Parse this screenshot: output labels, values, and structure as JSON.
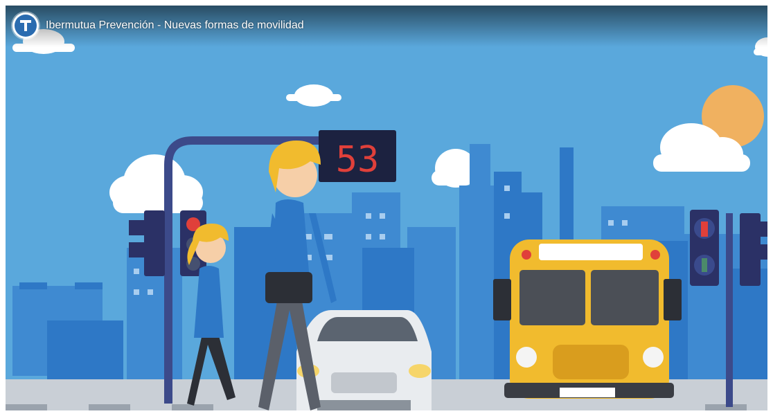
{
  "video": {
    "title": "Ibermutua Prevención - Nuevas formas de movilidad",
    "channel_logo_icon": "ibermutua-logo-icon"
  },
  "scene": {
    "counter_value": "53",
    "colors": {
      "sky": "#5aa8dc",
      "skyline": "#2e78c6",
      "skyline_light": "#3f8ad1",
      "road": "#c9cfd6",
      "bus": "#f1bb2e",
      "sun": "#f0b160",
      "counter_digits": "#e0403a"
    },
    "icons": [
      "traffic-light-icon",
      "pedestrian-signal-icon",
      "countdown-display-icon",
      "school-bus-icon",
      "car-icon",
      "sun-icon",
      "cloud-icon"
    ]
  }
}
